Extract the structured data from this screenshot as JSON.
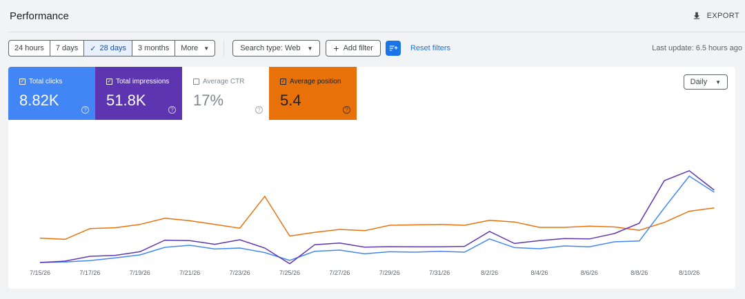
{
  "header": {
    "title": "Performance",
    "export_label": "EXPORT",
    "export_icon": "download-icon"
  },
  "filters": {
    "date_ranges": [
      {
        "label": "24 hours",
        "active": false
      },
      {
        "label": "7 days",
        "active": false
      },
      {
        "label": "28 days",
        "active": true
      },
      {
        "label": "3 months",
        "active": false
      },
      {
        "label": "More",
        "active": false
      }
    ],
    "search_type_label": "Search type: Web",
    "add_filter_label": "Add filter",
    "reset_label": "Reset filters",
    "last_update": "Last update: 6.5 hours ago"
  },
  "metrics": {
    "clicks": {
      "label": "Total clicks",
      "value": "8.82K",
      "checked": true,
      "color": "#4285f4"
    },
    "impressions": {
      "label": "Total impressions",
      "value": "51.8K",
      "checked": true,
      "color": "#5e35b1"
    },
    "ctr": {
      "label": "Average CTR",
      "value": "17%",
      "checked": false
    },
    "position": {
      "label": "Average position",
      "value": "5.4",
      "checked": true,
      "color": "#e8710a"
    }
  },
  "granularity": {
    "label": "Daily"
  },
  "chart_data": {
    "type": "line",
    "x": [
      "7/15/26",
      "7/16/26",
      "7/17/26",
      "7/18/26",
      "7/19/26",
      "7/20/26",
      "7/21/26",
      "7/22/26",
      "7/23/26",
      "7/24/26",
      "7/25/26",
      "7/26/26",
      "7/27/26",
      "7/28/26",
      "7/29/26",
      "7/30/26",
      "7/31/26",
      "8/1/26",
      "8/2/26",
      "8/3/26",
      "8/4/26",
      "8/5/26",
      "8/6/26",
      "8/7/26",
      "8/8/26",
      "8/9/26",
      "8/10/26",
      "8/11/26"
    ],
    "x_tick_labels": [
      "7/15/26",
      "7/17/26",
      "7/19/26",
      "7/21/26",
      "7/23/26",
      "7/25/26",
      "7/27/26",
      "7/29/26",
      "7/31/26",
      "8/2/26",
      "8/4/26",
      "8/6/26",
      "8/8/26",
      "8/10/26"
    ],
    "series": [
      {
        "name": "Total clicks",
        "color": "#4285f4",
        "values": [
          0.0,
          0.8,
          2.8,
          6.6,
          11.0,
          22.0,
          25.0,
          19.6,
          21.0,
          14.4,
          3.0,
          16.2,
          18.0,
          12.6,
          15.6,
          15.0,
          16.2,
          15.0,
          34.2,
          21.6,
          20.0,
          24.0,
          22.8,
          30.0,
          31.2,
          79.2,
          125.4,
          102.0
        ]
      },
      {
        "name": "Total impressions",
        "color": "#5e35b1",
        "values": [
          0.0,
          2.0,
          9.0,
          10.2,
          15.6,
          32.4,
          31.8,
          26.4,
          33.0,
          21.0,
          -1.8,
          25.8,
          28.2,
          22.2,
          23.0,
          22.8,
          22.8,
          23.4,
          45.0,
          27.6,
          31.8,
          34.8,
          34.2,
          42.0,
          57.0,
          118.8,
          133.2,
          105.0
        ]
      },
      {
        "name": "Average position",
        "color": "#e8710a",
        "values": [
          35.4,
          33.6,
          49.2,
          50.4,
          55.2,
          64.2,
          60.6,
          55.2,
          49.8,
          96.0,
          38.4,
          43.8,
          48.0,
          46.2,
          54.0,
          54.6,
          55.2,
          54.0,
          61.2,
          58.8,
          51.0,
          51.0,
          52.8,
          51.6,
          46.8,
          58.2,
          74.4,
          79.2
        ]
      }
    ]
  }
}
